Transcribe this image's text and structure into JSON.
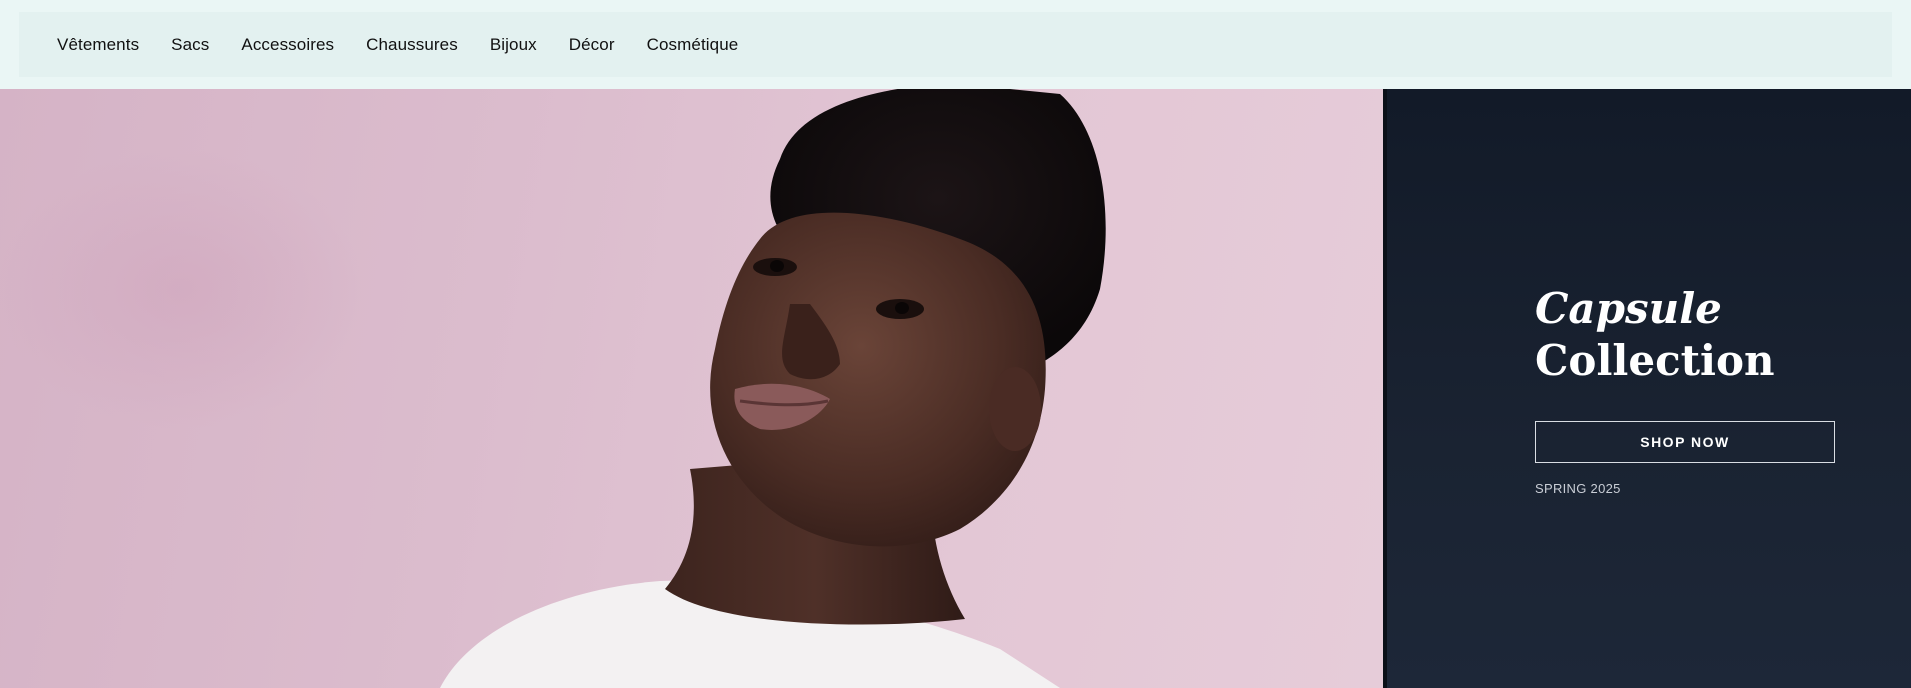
{
  "nav": {
    "items": [
      {
        "label": "Vêtements"
      },
      {
        "label": "Sacs"
      },
      {
        "label": "Accessoires"
      },
      {
        "label": "Chaussures"
      },
      {
        "label": "Bijoux"
      },
      {
        "label": "Décor"
      },
      {
        "label": "Cosmétique"
      }
    ]
  },
  "hero": {
    "image": "portrait-photo",
    "title_line1": "Capsule",
    "title_line2": "Collection",
    "cta_label": "SHOP NOW",
    "season": "SPRING 2025"
  },
  "colors": {
    "nav_background": "#e3f1f0",
    "photo_background": "#dcbdcd",
    "panel_background": "#161f2d",
    "text_on_dark": "#ffffff"
  }
}
